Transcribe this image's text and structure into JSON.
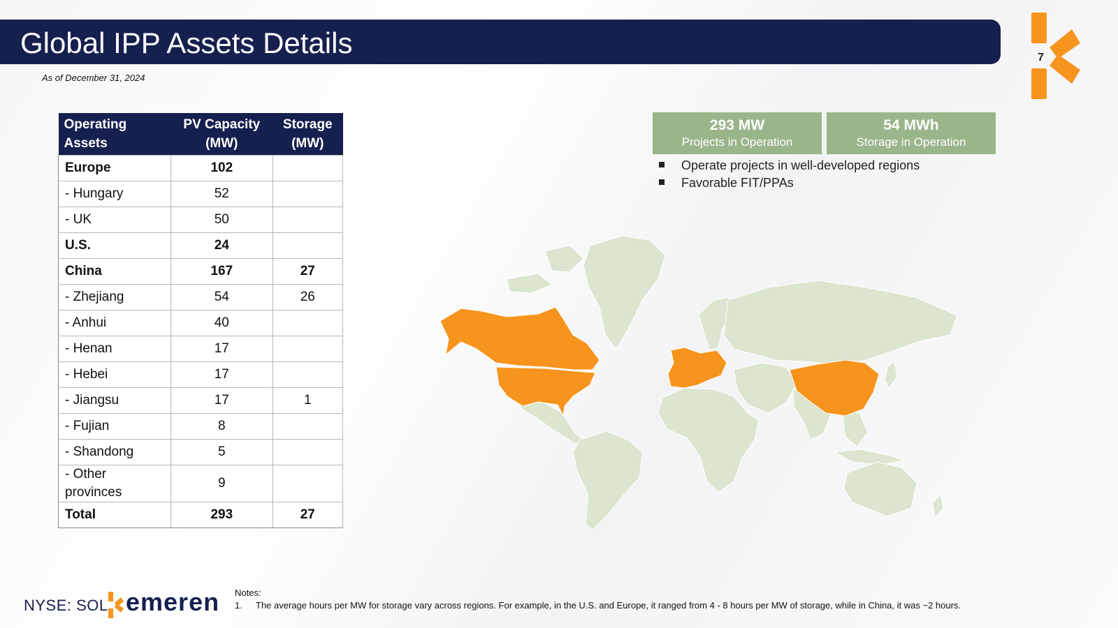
{
  "title": "Global IPP Assets Details",
  "as_of": "As of December 31, 2024",
  "page_number": "7",
  "table": {
    "headers": [
      [
        "Operating",
        "Assets"
      ],
      [
        "PV Capacity",
        "(MW)"
      ],
      [
        "Storage",
        "(MW)"
      ]
    ],
    "rows": [
      {
        "label": "Europe",
        "pv": "102",
        "storage": "",
        "bold": true
      },
      {
        "label": "-   Hungary",
        "pv": "52",
        "storage": ""
      },
      {
        "label": "-   UK",
        "pv": "50",
        "storage": ""
      },
      {
        "label": "U.S.",
        "pv": "24",
        "storage": "",
        "bold": true
      },
      {
        "label": "China",
        "pv": "167",
        "storage": "27",
        "bold": true
      },
      {
        "label": "- Zhejiang",
        "pv": "54",
        "storage": "26"
      },
      {
        "label": "- Anhui",
        "pv": "40",
        "storage": ""
      },
      {
        "label": "- Henan",
        "pv": "17",
        "storage": ""
      },
      {
        "label": "- Hebei",
        "pv": "17",
        "storage": ""
      },
      {
        "label": "- Jiangsu",
        "pv": "17",
        "storage": "1"
      },
      {
        "label": "- Fujian",
        "pv": "8",
        "storage": ""
      },
      {
        "label": "- Shandong",
        "pv": "5",
        "storage": ""
      },
      {
        "label": "- Other provinces",
        "pv": "9",
        "storage": "",
        "tall": true
      },
      {
        "label": "Total",
        "pv": "293",
        "storage": "27",
        "bold": true
      }
    ]
  },
  "kpis": [
    {
      "value": "293 MW",
      "label": "Projects in Operation"
    },
    {
      "value": "54 MWh",
      "label": "Storage in Operation"
    }
  ],
  "bullets": [
    "Operate projects in well-developed regions",
    "Favorable FIT/PPAs"
  ],
  "map": {
    "highlight_color": "#f7941d",
    "land_color": "#dbe5cf"
  },
  "footer": {
    "ticker": "NYSE: SOL",
    "brand": "emeren",
    "notes_heading": "Notes:",
    "note_number": "1.",
    "note_text": "The average hours per MW for storage vary across regions. For example, in the U.S. and Europe, it ranged from 4 - 8 hours per MW of storage, while in China, it was ~2 hours."
  },
  "colors": {
    "navy": "#16204f",
    "kpi_green": "#9bb58a",
    "orange": "#f7941d"
  }
}
